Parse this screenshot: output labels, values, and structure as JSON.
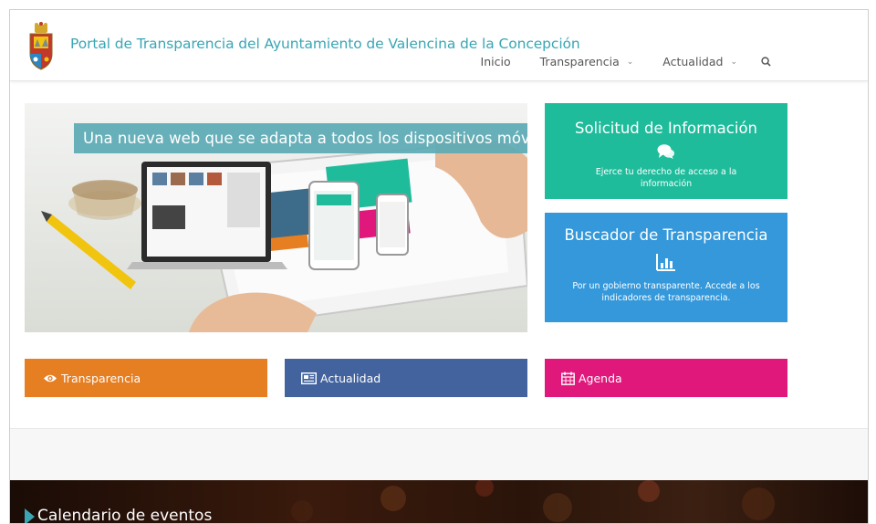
{
  "header": {
    "site_title": "Portal de Transparencia del Ayuntamiento de Valencina de la Concepción",
    "nav": [
      {
        "label": "Inicio"
      },
      {
        "label": "Transparencia"
      },
      {
        "label": "Actualidad"
      }
    ]
  },
  "hero": {
    "caption": "Una nueva web que se adapta a todos los dispositivos móviles"
  },
  "tiles": {
    "solicitud": {
      "title": "Solicitud de Información",
      "text": "Ejerce tu derecho de acceso a la información",
      "icon": "comments-icon",
      "color": "#1fbc9c"
    },
    "buscador": {
      "title": "Buscador de Transparencia",
      "text": "Por un gobierno transparente. Accede a los indicadores de transparencia.",
      "icon": "bar-chart-icon",
      "color": "#3498db"
    }
  },
  "buttons": {
    "transparencia": {
      "label": "Transparencia",
      "icon": "eye-icon",
      "color": "#e67e22"
    },
    "actualidad": {
      "label": "Actualidad",
      "icon": "newspaper-icon",
      "color": "#43639e"
    },
    "agenda": {
      "label": "Agenda",
      "icon": "calendar-icon",
      "color": "#e0187c"
    }
  },
  "events": {
    "title": "Calendario de eventos"
  },
  "colors": {
    "accent": "#3aa6b4"
  }
}
